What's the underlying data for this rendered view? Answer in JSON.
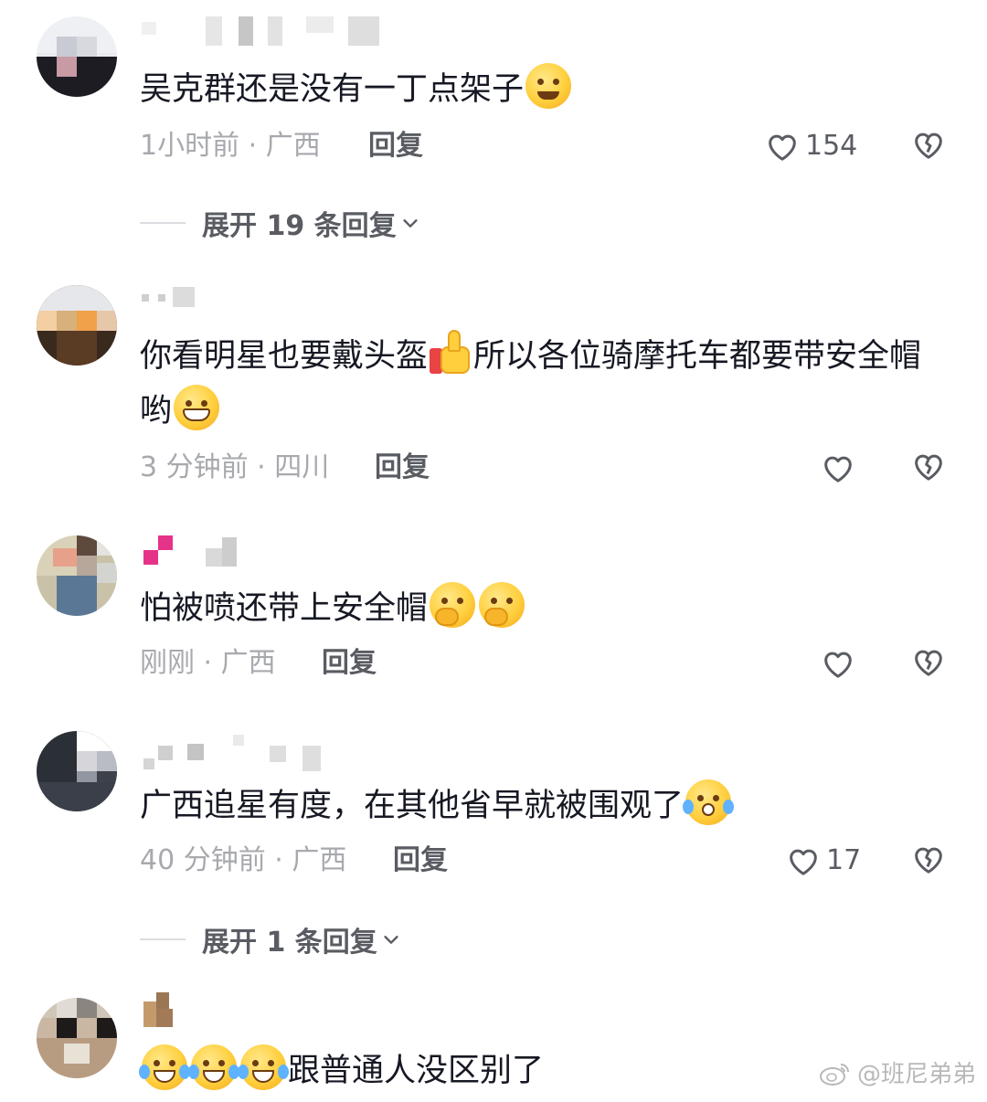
{
  "comments": [
    {
      "text": "吴克群还是没有一丁点架子",
      "time_location": "1小时前 · 广西",
      "reply_label": "回复",
      "likes": "154",
      "expand_label": "展开 19 条回复"
    },
    {
      "text_a": "你看明星也要戴头盔",
      "text_b": "所以各位骑摩托车都要带安全帽哟",
      "time_location": "3 分钟前 · 四川",
      "reply_label": "回复"
    },
    {
      "text": "怕被喷还带上安全帽",
      "time_location": "刚刚 · 广西",
      "reply_label": "回复"
    },
    {
      "text": "广西追星有度，在其他省早就被围观了",
      "time_location": "40 分钟前 · 广西",
      "reply_label": "回复",
      "likes": "17",
      "expand_label": "展开 1 条回复"
    },
    {
      "text": "跟普通人没区别了"
    }
  ],
  "watermark": "@班尼弟弟",
  "colors": {
    "text": "#161823",
    "meta": "#a7a9ae",
    "action": "#5a5c63"
  }
}
